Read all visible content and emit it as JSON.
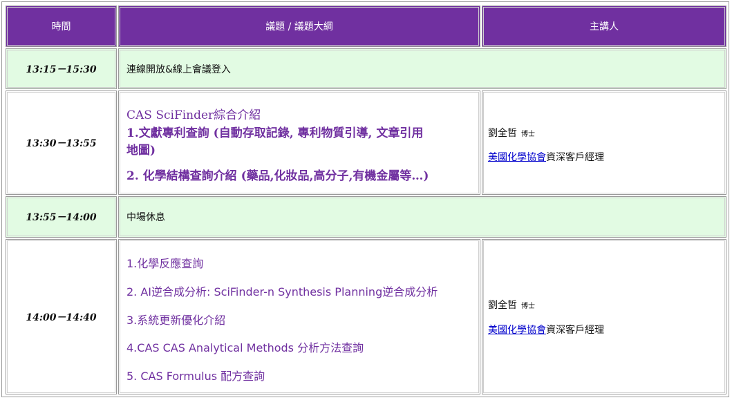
{
  "headers": {
    "time": "時間",
    "topic": "議題 / 議題大綱",
    "speaker": "主講人"
  },
  "rows": [
    {
      "time": "13:15－15:30",
      "text": "連線開放&線上會議登入"
    },
    {
      "time": "13:30－13:55",
      "agenda": {
        "title": "CAS SciFinder綜合介紹",
        "item1_line1": "1.文獻專利查詢 (自動存取記錄, 專利物質引導, 文章引用",
        "item1_line2": "地圖)",
        "item2": "2. 化學結構查詢介紹 (藥品,化妝品,高分子,有機金屬等…)"
      },
      "speaker": {
        "name": "劉全哲",
        "degree": "博士",
        "org_link": "美國化學協會",
        "role": "資深客戶經理"
      }
    },
    {
      "time": "13:55－14:00",
      "text": "中場休息"
    },
    {
      "time": "14:00－14:40",
      "agenda_items": [
        "1.化學反應查詢",
        "2. AI逆合成分析: SciFinder-n Synthesis Planning逆合成分析",
        "3.系統更新優化介紹",
        "4.CAS CAS Analytical Methods 分析方法查詢",
        "5. CAS Formulus 配方查詢"
      ],
      "speaker": {
        "name": "劉全哲",
        "degree": "博士",
        "org_link": "美國化學協會",
        "role": "資深客戶經理"
      }
    }
  ],
  "colors": {
    "header_bg": "#7030a0",
    "break_row_bg": "#e2fbe3",
    "agenda_text": "#7030a0",
    "link": "#0000cc"
  }
}
